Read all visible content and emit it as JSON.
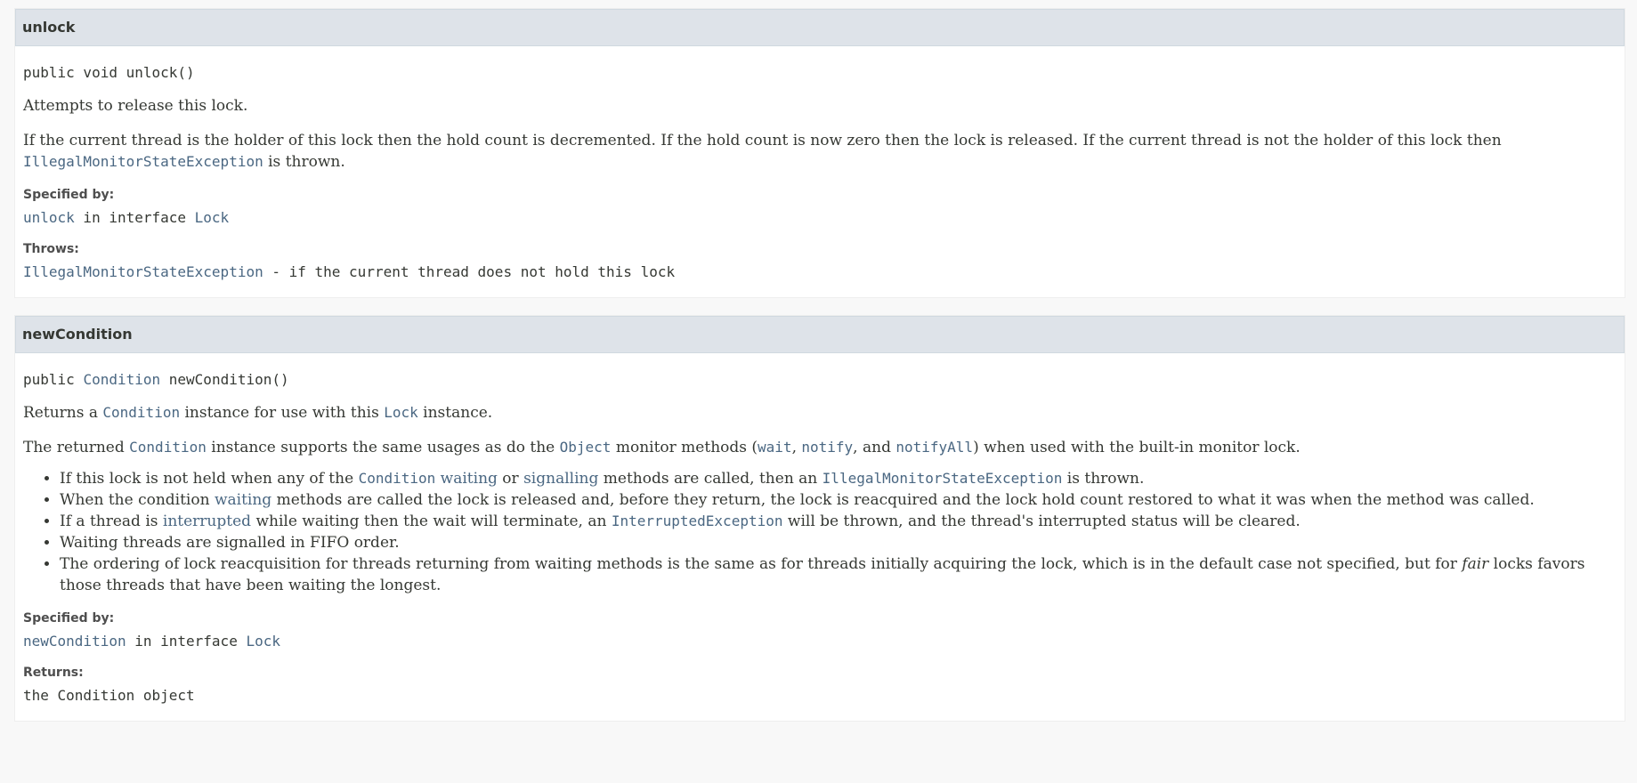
{
  "unlock": {
    "title": "unlock",
    "sig_prefix": "public void unlock()",
    "summary": "Attempts to release this lock.",
    "detail_text": "If the current thread is the holder of this lock then the hold count is decremented. If the hold count is now zero then the lock is released. If the current thread is not the holder of this lock then",
    "detail_link": "IllegalMonitorStateException",
    "detail_tail": " is thrown.",
    "specified_label": "Specified by:",
    "specified_method": "unlock",
    "specified_mid": " in interface ",
    "specified_iface": "Lock",
    "throws_label": "Throws:",
    "throws_link": "IllegalMonitorStateException",
    "throws_text": " - if the current thread does not hold this lock"
  },
  "newCondition": {
    "title": "newCondition",
    "sig_prefix": "public ",
    "sig_type": "Condition",
    "sig_name": " newCondition()",
    "summary_a": "Returns a ",
    "summary_link1": "Condition",
    "summary_b": " instance for use with this ",
    "summary_link2": "Lock",
    "summary_c": " instance.",
    "p2_a": "The returned ",
    "p2_link1": "Condition",
    "p2_b": " instance supports the same usages as do the ",
    "p2_link2": "Object",
    "p2_c": " monitor methods (",
    "p2_wait": "wait",
    "p2_sep1": ", ",
    "p2_notify": "notify",
    "p2_sep2": ", and ",
    "p2_notifyAll": "notifyAll",
    "p2_d": ") when used with the built-in monitor lock.",
    "bullets": {
      "b1_a": "If this lock is not held when any of the ",
      "b1_cond": "Condition",
      "b1_sp": " ",
      "b1_waiting": "waiting",
      "b1_or": " or ",
      "b1_signalling": "signalling",
      "b1_b": " methods are called, then an ",
      "b1_exc": "IllegalMonitorStateException",
      "b1_c": " is thrown.",
      "b2_a": "When the condition ",
      "b2_waiting": "waiting",
      "b2_b": " methods are called the lock is released and, before they return, the lock is reacquired and the lock hold count restored to what it was when the method was called.",
      "b3_a": "If a thread is ",
      "b3_interrupted": "interrupted",
      "b3_b": " while waiting then the wait will terminate, an ",
      "b3_exc": "InterruptedException",
      "b3_c": " will be thrown, and the thread's interrupted status will be cleared.",
      "b4": "Waiting threads are signalled in FIFO order.",
      "b5_a": "The ordering of lock reacquisition for threads returning from waiting methods is the same as for threads initially acquiring the lock, which is in the default case not specified, but for ",
      "b5_fair": "fair",
      "b5_b": " locks favors those threads that have been waiting the longest."
    },
    "specified_label": "Specified by:",
    "specified_method": "newCondition",
    "specified_mid": " in interface ",
    "specified_iface": "Lock",
    "returns_label": "Returns:",
    "returns_text": "the Condition object"
  }
}
